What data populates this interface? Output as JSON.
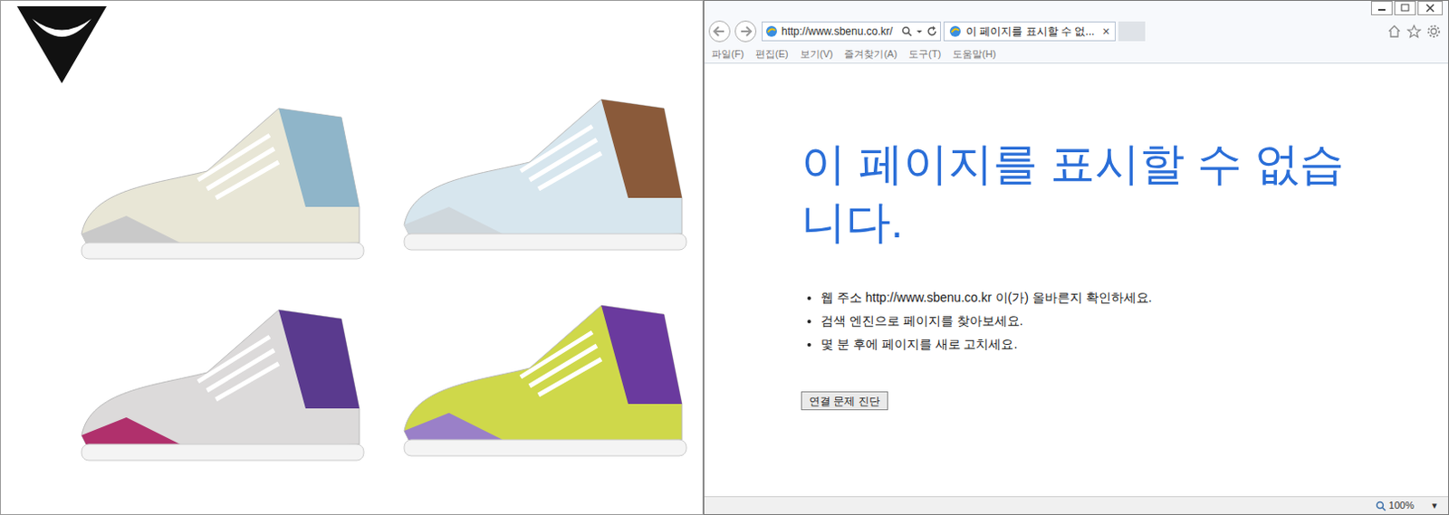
{
  "browser": {
    "address": "http://www.sbenu.co.kr/",
    "tabs": [
      {
        "label": "이 페이지를 표시할 수 없...",
        "selected": true,
        "close": "×"
      }
    ],
    "menu": [
      "파일(F)",
      "편집(E)",
      "보기(V)",
      "즐겨찾기(A)",
      "도구(T)",
      "도움말(H)"
    ]
  },
  "page": {
    "heading": "이 페이지를 표시할 수 없습니다.",
    "suggestions": [
      "웹 주소 http://www.sbenu.co.kr 이(가) 올바른지 확인하세요.",
      "검색 엔진으로 페이지를 찾아보세요.",
      "몇 분 후에 페이지를 새로 고치세요."
    ],
    "button": "연결 문제 진단"
  },
  "status_bar": {
    "zoom": "100%",
    "zoom_menu": "▾"
  }
}
